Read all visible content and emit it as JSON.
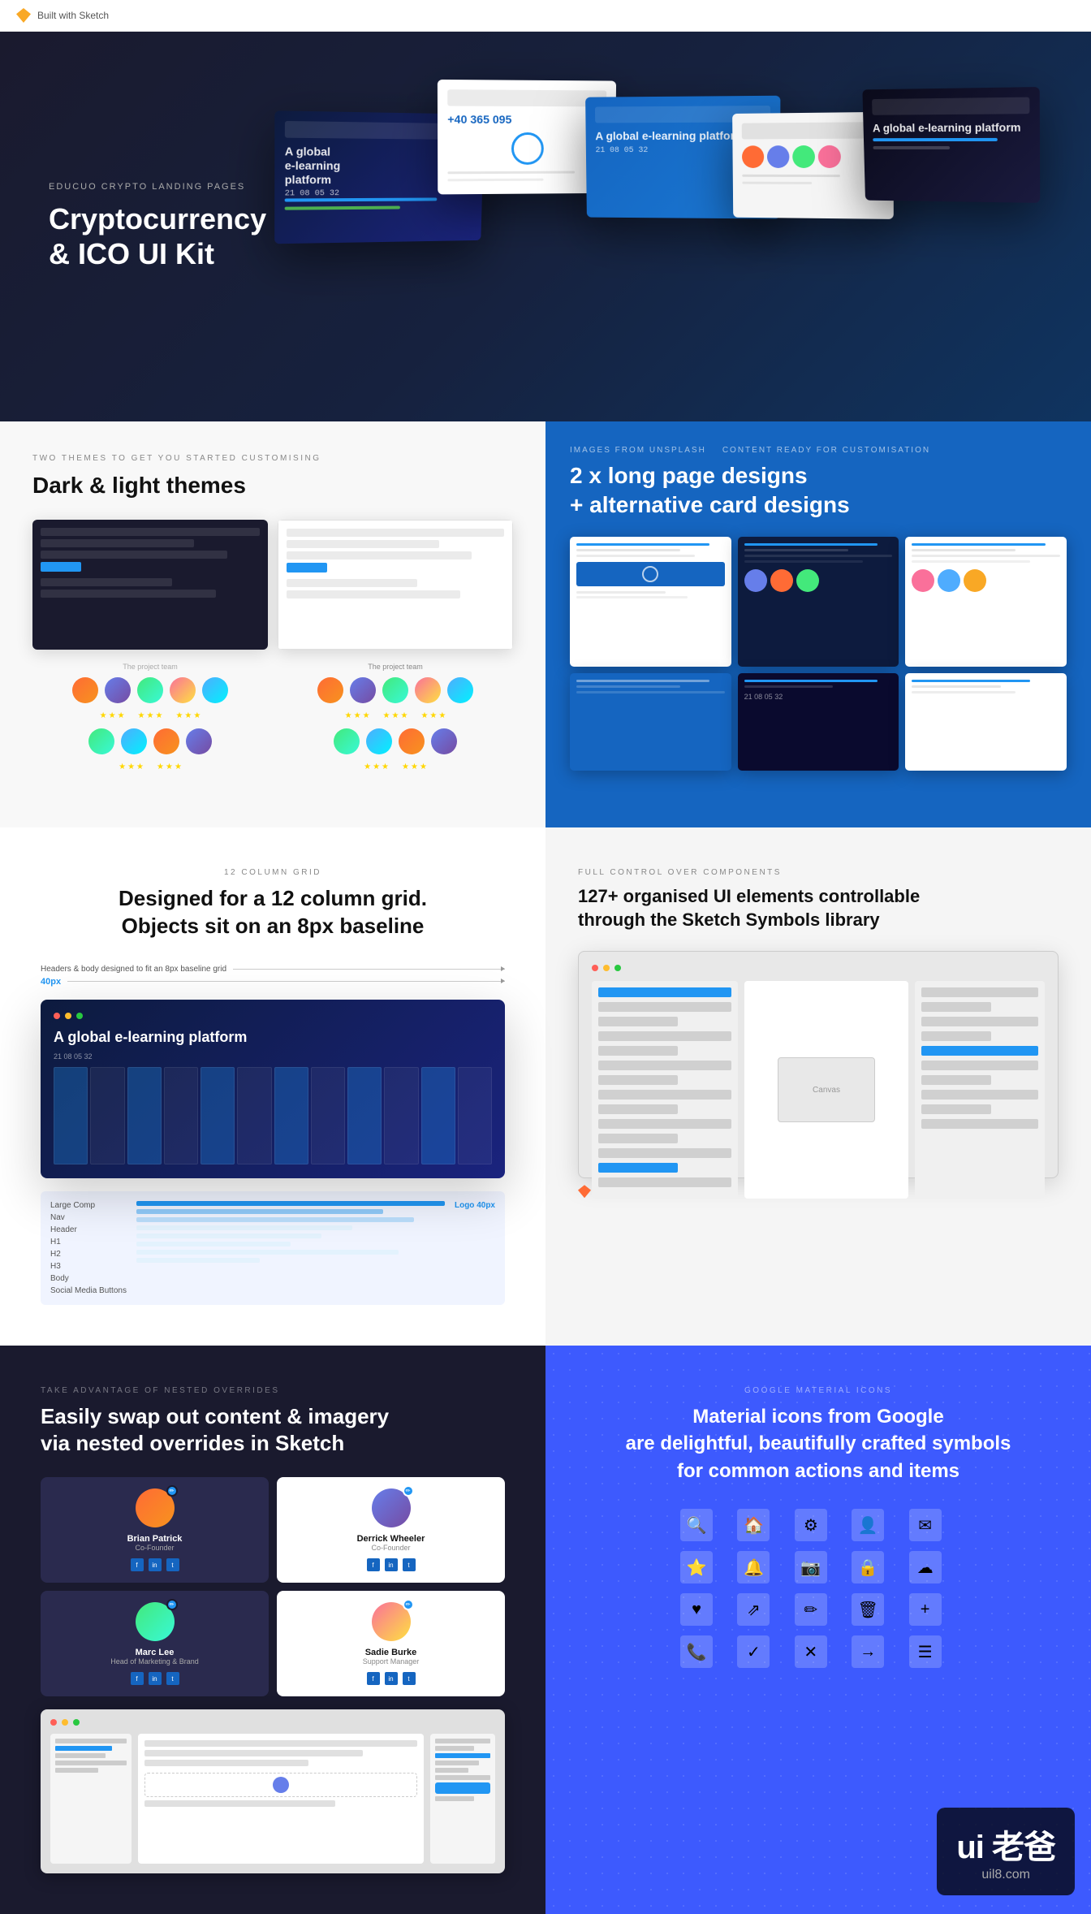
{
  "header": {
    "logo_text": "Built with Sketch"
  },
  "hero": {
    "subtitle": "EDUCUO CRYPTO LANDING PAGES",
    "title_line1": "Cryptocurrency",
    "title_line2": "& ICO UI Kit"
  },
  "themes_section": {
    "label": "TWO THEMES TO GET YOU STARTED CUSTOMISING",
    "title": "Dark & light themes",
    "team_label": "The project team"
  },
  "long_pages_section": {
    "label1": "Images from Unsplash",
    "label2": "CONTENT READY FOR CUSTOMISATION",
    "title_line1": "2 x long page designs",
    "title_line2": "+ alternative card designs"
  },
  "grid_section": {
    "label": "12 COLUMN GRID",
    "title_line1": "Designed for a 12 column grid.",
    "title_line2": "Objects sit on an 8px baseline",
    "label1": "Headers & body designed to fit an 8px baseline grid",
    "label2": "40px"
  },
  "components_section": {
    "label": "FULL CONTROL OVER COMPONENTS",
    "title_line1": "127+ organised UI elements controllable",
    "title_line2": "through the Sketch Symbols library",
    "sketch_label": "Sketch Symbols"
  },
  "overrides_section": {
    "label": "TAKE ADVANTAGE OF NESTED OVERRIDES",
    "title_line1": "Easily swap out content & imagery",
    "title_line2": "via nested overrides in Sketch",
    "person1_name": "Brian Patrick",
    "person1_role": "Co-Founder",
    "person2_name": "Derrick Wheeler",
    "person2_role": "Co-Founder",
    "person3_name": "Marc Lee",
    "person3_role": "Head of Marketing & Brand",
    "person4_name": "Sadie Burke",
    "person4_role": "Support Manager"
  },
  "material_section": {
    "label": "GOOGLE MATERIAL ICONS",
    "title_line1": "Material icons from Google",
    "title_line2": "are delightful, beautifully crafted symbols",
    "title_line3": "for common actions and items"
  },
  "watermark": {
    "main": "ui 老爸",
    "sub": "uil8.com"
  },
  "icons": {
    "search": "🔍",
    "settings": "⚙",
    "home": "🏠",
    "star": "⭐",
    "heart": "♥",
    "mail": "✉",
    "bell": "🔔",
    "lock": "🔒",
    "cloud": "☁",
    "camera": "📷",
    "phone": "📞",
    "person": "👤",
    "menu": "☰",
    "check": "✓",
    "close": "✕",
    "arrow": "→",
    "share": "⇗",
    "edit": "✏",
    "delete": "🗑",
    "add": "+"
  }
}
